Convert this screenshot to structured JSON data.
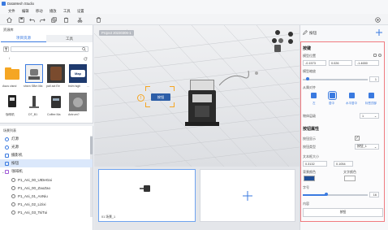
{
  "app": {
    "title": "DataMesh Studio"
  },
  "menu": [
    "文件",
    "编辑",
    "移动",
    "播放",
    "工具",
    "设置"
  ],
  "left": {
    "asset_panel_title": "资源库",
    "tabs": [
      "项目资源",
      "工具"
    ],
    "path": "/",
    "assets_row1": [
      "Asus cisnd",
      "shsm SBm Ma",
      "pall act Ee",
      "bslm lsgh",
      "..."
    ],
    "assets_row2": [
      "咖啡机",
      "DT_B1",
      "Coffee Ma",
      "Antrum?"
    ],
    "scene_panel_title": "场景列表",
    "scene_items": [
      "灯源",
      "光源",
      "摄影机",
      "按钮",
      "咖啡机",
      "P1_Ani_00_UtDeGai",
      "P1_Ani_00_ZaoZao",
      "P1_Ani_01_AnNiu",
      "P1_Ani_02_Lizixi",
      "P1_Ani_03_TsiTui"
    ]
  },
  "viewport": {
    "project_label": "Project 20230306-1",
    "button_label": "按钮",
    "warning": "!"
  },
  "bottom": {
    "slot_label": "01 场景_1"
  },
  "right": {
    "header_label": "按钮",
    "section1": "按键",
    "pos_label": "模型位置",
    "pos": [
      "-0.1573",
      "0.026",
      "-1.4650"
    ],
    "scale_label": "模型缩放",
    "scale_value": "1",
    "sym_label": "从属对齐",
    "align_labels": [
      "左",
      "居中",
      "水平居中",
      "标签顶部"
    ],
    "layer_label": "物体层级",
    "layer_value": "1",
    "section2": "按钮属性",
    "visible_label": "按钮显示",
    "type_label": "按钮类型",
    "type_value": "按钮_1",
    "size_label": "文本框大小",
    "size": [
      "0.3132",
      "0.1054"
    ],
    "bg_label": "背景颜色",
    "text_color_label": "文字颜色",
    "font_label": "字号",
    "font_value": "16",
    "content_label": "内容",
    "content_value": "按钮",
    "colors": {
      "accent": "#3a7ae0",
      "highlight": "#f07b80",
      "orange": "#f5a623"
    }
  }
}
